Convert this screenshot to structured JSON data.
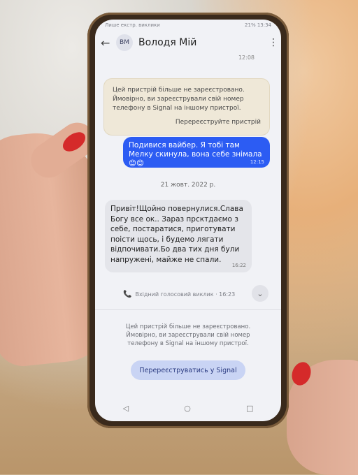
{
  "status_bar": {
    "left": "Лише екстр. виклики",
    "right": "21% 13:34"
  },
  "header": {
    "back_icon": "←",
    "avatar": "ВМ",
    "name": "Володя Мій",
    "menu_icon": "⋮"
  },
  "timestamp_top": "12:08",
  "warning": {
    "text": "Цей пристрій більше не зареєстровано. Ймовірно, ви зареєстрували свій номер телефону в Signal на іншому пристрої.",
    "link": "Перереєструйте пристрій"
  },
  "outgoing_message": {
    "text": "Подивися вайбер. Я тобі там Мелку скинула, вона себе знімала 😊😊",
    "time": "12:15"
  },
  "date_separator": "21 жовт. 2022 р.",
  "incoming_message": {
    "text": "Привіт!Щойно повернулися.Слава Богу все ок.. Зараз прсктдаємо з себе, постаратися, приготувати поісти щось, і будемо лягати відпочивати.Бо два тих дня були напружені, майже не спали.",
    "time": "16:22"
  },
  "call_row": {
    "icon": "📞",
    "label": "Вхідний голосовий виклик · 16:23",
    "chevron": "⌄"
  },
  "bottom_notice": "Цей пристрій більше не зареєстровано. Ймовірно, ви зареєстрували свій номер телефону в Signal на іншому пристрої.",
  "reregister_button": "Перереєструватись у Signal",
  "nav": {
    "back": "◁",
    "home": "○",
    "recent": "□"
  }
}
